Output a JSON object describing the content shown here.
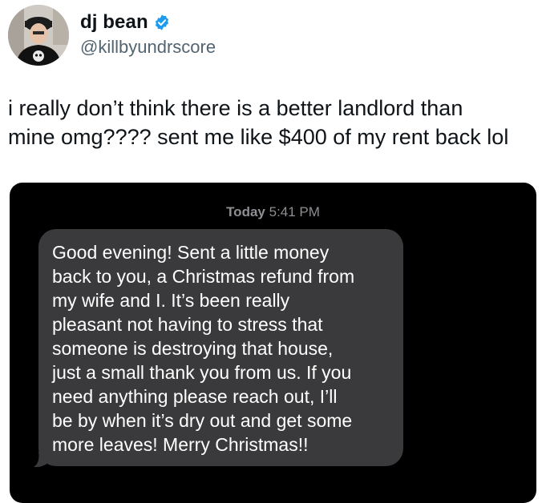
{
  "tweet": {
    "author": {
      "display_name": "dj bean",
      "handle": "@killbyundrscore",
      "verified_icon": "verified-badge-icon",
      "verified_color": "#1d9bf0"
    },
    "text_lines": [
      "i really don’t think there is a better landlord than",
      "mine omg???? sent me like $400 of my rent back lol"
    ]
  },
  "message_screenshot": {
    "timestamp_day": "Today",
    "timestamp_time": "5:41 PM",
    "bubble_lines": [
      "Good evening!  Sent a little money",
      "back to you, a Christmas refund from",
      "my wife and I. It’s been really",
      "pleasant not having to stress that",
      "someone is destroying that house,",
      "just a small thank you from us. If you",
      "need anything please reach out, I’ll",
      "be by when it’s dry out and get some",
      "more leaves!  Merry Christmas!!"
    ],
    "bubble_color": "#3a3a3c",
    "background_color": "#000000"
  }
}
